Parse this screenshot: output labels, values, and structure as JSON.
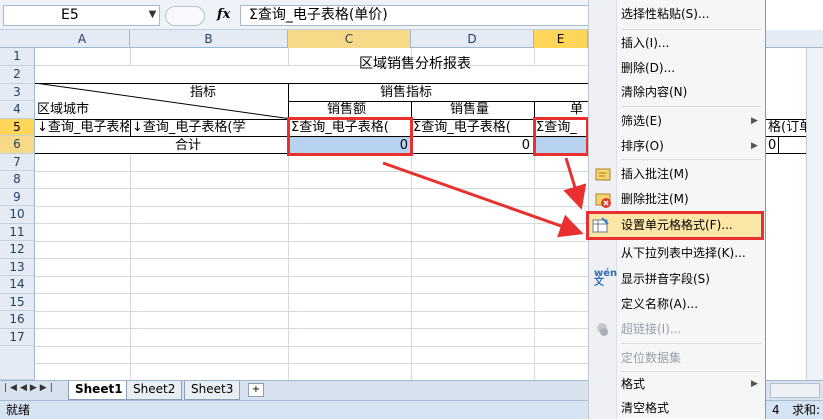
{
  "formula_bar": {
    "name_box": "E5",
    "fx_label": "fx",
    "formula": "Σ查询_电子表格(单价)"
  },
  "columns": [
    "A",
    "B",
    "C",
    "D",
    "E"
  ],
  "rows": [
    "1",
    "2",
    "3",
    "4",
    "5",
    "6",
    "7",
    "8",
    "9",
    "10",
    "11",
    "12",
    "13",
    "14",
    "15",
    "16",
    "17"
  ],
  "cells": {
    "title": "区域销售分析报表",
    "b3_label": "指标",
    "sales_indicator": "销售指标",
    "a4_label": "区域城市",
    "c4_label": "销售额",
    "d4_label": "销售量",
    "e4_partial": "单",
    "a5": "↓查询_电子表格(",
    "b5": "↓查询_电子表格(学",
    "c5": "Σ查询_电子表格(",
    "d5": "Σ查询_电子表格(",
    "e5": "Σ查询_",
    "f5_partial": "格(订单",
    "total_label": "合计",
    "c6": "0",
    "d6": "0",
    "f6": "0"
  },
  "sheet_tabs": [
    "Sheet1",
    "Sheet2",
    "Sheet3"
  ],
  "status": {
    "ready": "就绪",
    "page_num": "4",
    "sum_label": "求和:"
  },
  "context_menu": {
    "items": [
      {
        "label": "选择性粘贴(S)...",
        "disabled": false
      },
      {
        "label": "插入(I)...",
        "disabled": false
      },
      {
        "label": "删除(D)...",
        "disabled": false
      },
      {
        "label": "清除内容(N)",
        "disabled": false
      },
      {
        "label": "筛选(E)",
        "disabled": false,
        "submenu": true
      },
      {
        "label": "排序(O)",
        "disabled": false,
        "submenu": true
      },
      {
        "label": "插入批注(M)",
        "disabled": false,
        "icon": "insert-comment-icon"
      },
      {
        "label": "删除批注(M)",
        "disabled": false,
        "icon": "delete-comment-icon"
      },
      {
        "label": "设置单元格格式(F)...",
        "disabled": false,
        "icon": "format-cells-icon",
        "highlighted": true
      },
      {
        "label": "从下拉列表中选择(K)...",
        "disabled": false
      },
      {
        "label": "显示拼音字段(S)",
        "disabled": false,
        "icon": "phonetic-icon"
      },
      {
        "label": "定义名称(A)...",
        "disabled": false
      },
      {
        "label": "超链接(I)...",
        "disabled": true,
        "icon": "hyperlink-icon"
      },
      {
        "label": "定位数据集",
        "disabled": true
      },
      {
        "label": "格式",
        "disabled": false,
        "submenu": true
      },
      {
        "label": "清空格式",
        "disabled": false
      }
    ]
  },
  "colors": {
    "highlight_red": "#e8302f",
    "selected_cell_fill": "#b8d3f0",
    "menu_hover": "#fde7a6"
  }
}
